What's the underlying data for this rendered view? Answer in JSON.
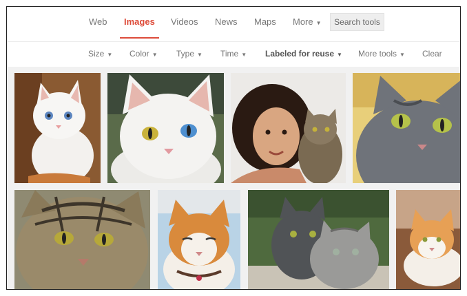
{
  "nav": {
    "tabs": [
      {
        "label": "Web"
      },
      {
        "label": "Images"
      },
      {
        "label": "Videos"
      },
      {
        "label": "News"
      },
      {
        "label": "Maps"
      },
      {
        "label": "More"
      }
    ],
    "active_tab": "Images",
    "search_tools": "Search tools"
  },
  "tools": {
    "items": [
      {
        "label": "Size"
      },
      {
        "label": "Color"
      },
      {
        "label": "Type"
      },
      {
        "label": "Time"
      },
      {
        "label": "Labeled for reuse"
      },
      {
        "label": "More tools"
      },
      {
        "label": "Clear"
      }
    ]
  },
  "colors": {
    "accent": "#dd4b39",
    "tab_text": "#777777",
    "tools_bg": "#eeeeee"
  }
}
